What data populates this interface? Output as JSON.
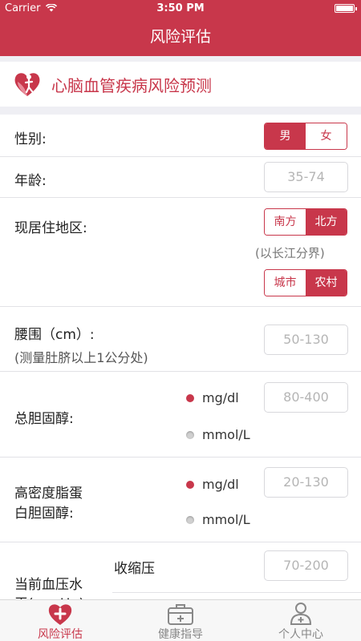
{
  "status_bar": {
    "carrier": "Carrier",
    "time": "3:50 PM"
  },
  "nav": {
    "title": "风险评估"
  },
  "banner": {
    "title": "心脑血管疾病风险预测"
  },
  "form": {
    "gender": {
      "label": "性别:",
      "options": [
        "男",
        "女"
      ],
      "selected": "男"
    },
    "age": {
      "label": "年龄:",
      "placeholder": "35-74"
    },
    "region": {
      "label": "现居住地区:",
      "direction_options": [
        "南方",
        "北方"
      ],
      "direction_selected": "北方",
      "hint": "(以长江分界)",
      "area_options": [
        "城市",
        "农村"
      ],
      "area_selected": "农村"
    },
    "waist": {
      "label": "腰围（cm）:",
      "sublabel": "(测量肚脐以上1公分处)",
      "placeholder": "50-130"
    },
    "cholesterol": {
      "label": "总胆固醇:",
      "units": [
        "mg/dl",
        "mmol/L"
      ],
      "selected_unit": "mg/dl",
      "placeholder": "80-400"
    },
    "hdl": {
      "label_line1": "高密度脂蛋",
      "label_line2": "白胆固醇:",
      "units": [
        "mg/dl",
        "mmol/L"
      ],
      "selected_unit": "mg/dl",
      "placeholder": "20-130"
    },
    "blood_pressure": {
      "label_line1": "当前血压水",
      "label_line2": "平(mmHg):",
      "systolic_label": "收缩压",
      "placeholder": "70-200"
    }
  },
  "tabbar": {
    "tabs": [
      {
        "label": "风险评估",
        "icon": "heart-plus-icon",
        "active": true
      },
      {
        "label": "健康指导",
        "icon": "medical-kit-icon",
        "active": false
      },
      {
        "label": "个人中心",
        "icon": "user-profile-icon",
        "active": false
      }
    ]
  },
  "colors": {
    "accent": "#c8374b",
    "background": "#efeff4",
    "placeholder": "#b5b5b5"
  }
}
